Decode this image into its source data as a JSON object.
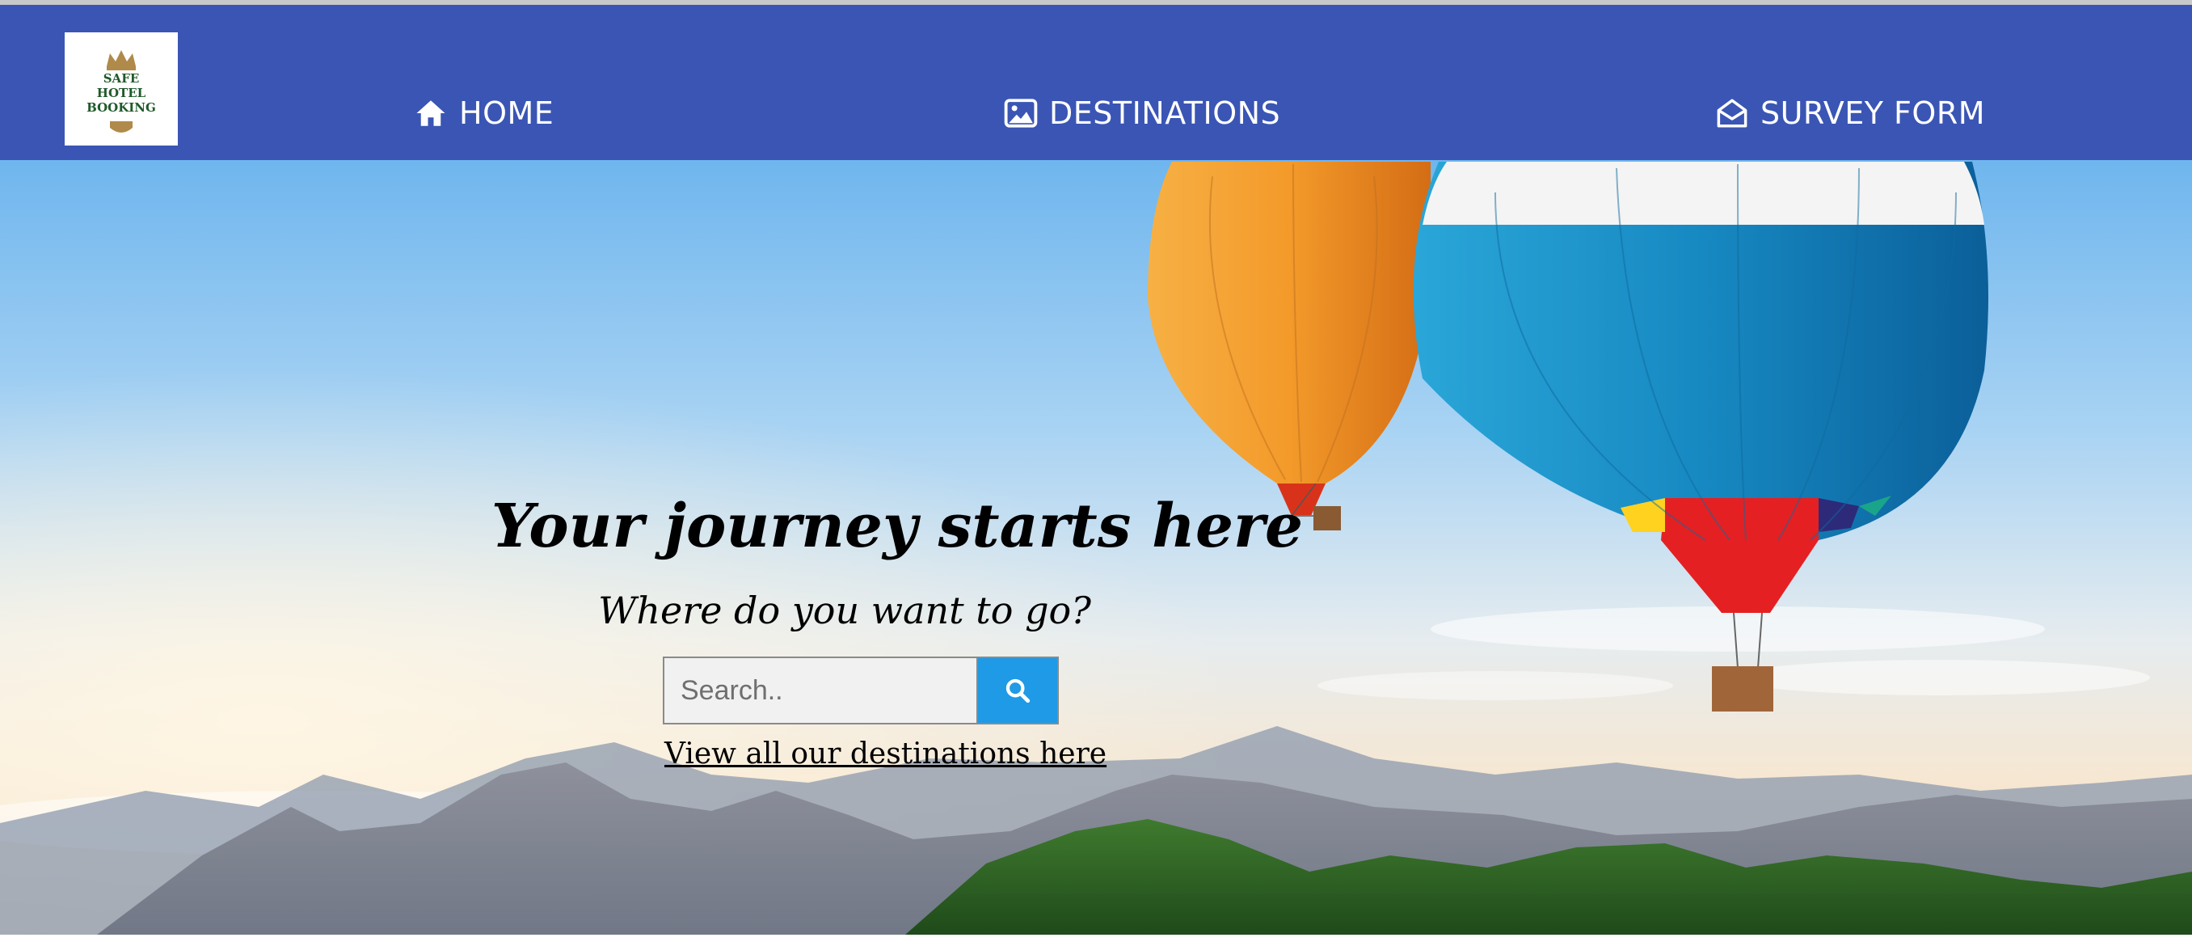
{
  "logo": {
    "lines": [
      "SAFE",
      "HOTEL",
      "BOOKING"
    ]
  },
  "nav": {
    "items": [
      {
        "label": "HOME",
        "icon": "home-icon"
      },
      {
        "label": "DESTINATIONS",
        "icon": "image-icon"
      },
      {
        "label": "SURVEY FORM",
        "icon": "envelope-open-icon"
      }
    ]
  },
  "hero": {
    "title": "Your journey starts here",
    "subtitle": "Where do you want to go?",
    "search_placeholder": "Search..",
    "search_icon": "search-icon",
    "link_text": "View all our destinations here"
  },
  "colors": {
    "navbar": "#3a55b4",
    "search_button": "#1e9ae6",
    "search_input_bg": "#f1f1f1"
  }
}
